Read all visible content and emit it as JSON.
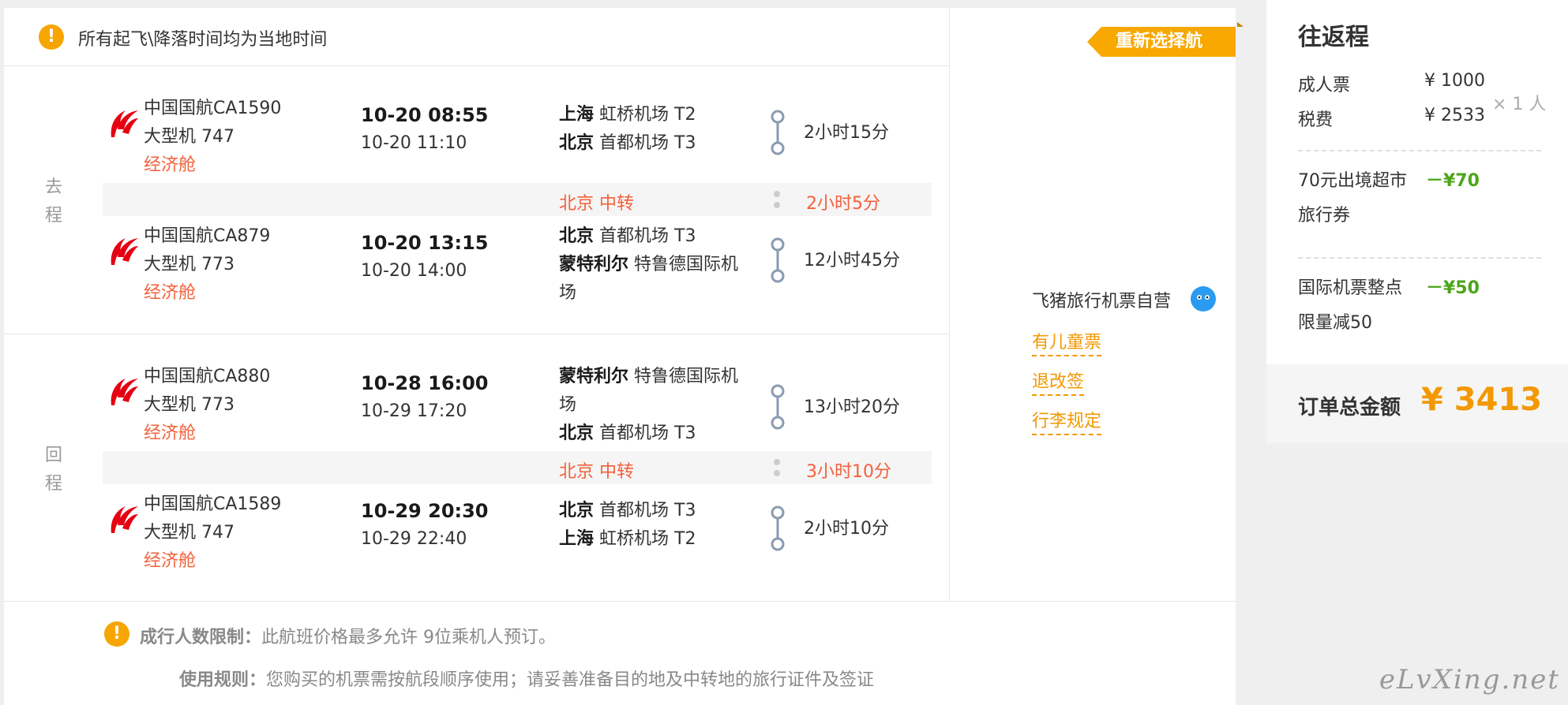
{
  "notice": "所有起飞\\降落时间均为当地时间",
  "reselect_label": "重新选择航班",
  "outbound": {
    "label_1": "去",
    "label_2": "程",
    "seg1": {
      "flight": "中国国航CA1590",
      "aircraft": "大型机 747",
      "cabin": "经济舱",
      "dep": "10-20 08:55",
      "arr": "10-20 11:10",
      "from_city": "上海",
      "from_airport": "虹桥机场 T2",
      "to_city": "北京",
      "to_airport": "首都机场 T3",
      "duration": "2小时15分"
    },
    "transfer": {
      "city": "北京 中转",
      "time": "2小时5分"
    },
    "seg2": {
      "flight": "中国国航CA879",
      "aircraft": "大型机 773",
      "cabin": "经济舱",
      "dep": "10-20 13:15",
      "arr": "10-20 14:00",
      "from_city": "北京",
      "from_airport": "首都机场 T3",
      "to_city": "蒙特利尔",
      "to_airport": "特鲁德国际机",
      "to_airport_2": "场",
      "duration": "12小时45分"
    }
  },
  "return": {
    "label_1": "回",
    "label_2": "程",
    "seg1": {
      "flight": "中国国航CA880",
      "aircraft": "大型机 773",
      "cabin": "经济舱",
      "dep": "10-28 16:00",
      "arr": "10-29 17:20",
      "from_city": "蒙特利尔",
      "from_airport": "特鲁德国际机",
      "from_airport_2": "场",
      "to_city": "北京",
      "to_airport": "首都机场 T3",
      "duration": "13小时20分"
    },
    "transfer": {
      "city": "北京 中转",
      "time": "3小时10分"
    },
    "seg2": {
      "flight": "中国国航CA1589",
      "aircraft": "大型机 747",
      "cabin": "经济舱",
      "dep": "10-29 20:30",
      "arr": "10-29 22:40",
      "from_city": "北京",
      "from_airport": "首都机场 T3",
      "to_city": "上海",
      "to_airport": "虹桥机场 T2",
      "duration": "2小时10分"
    }
  },
  "self_operated": "飞猪旅行机票自营",
  "links": {
    "child": "有儿童票",
    "refund": "退改签",
    "baggage": "行李规定"
  },
  "rules": {
    "limit_label": "成行人数限制：",
    "limit_text": "此航班价格最多允许 9位乘机人预订。",
    "usage_label": "使用规则：",
    "usage_text": "您购买的机票需按航段顺序使用；请妥善准备目的地及中转地的旅行证件及签证"
  },
  "watermark": "eLvXing.net",
  "sidebar": {
    "title": "往返程",
    "adult_label": "成人票",
    "adult_price": "¥ 1000",
    "tax_label": "税费",
    "tax_price": "¥ 2533",
    "multiplier": "× 1 人",
    "promo1_line1": "70元出境超市",
    "promo1_line2": "旅行券",
    "promo1_discount": "－¥70",
    "promo2_line1": "国际机票整点",
    "promo2_line2": "限量减50",
    "promo2_discount": "－¥50",
    "total_label": "订单总金额",
    "total_amount": "¥ 3413"
  },
  "colors": {
    "accent": "#f39800",
    "transfer": "#f4603a",
    "discount": "#4ca51a",
    "airline_red": "#e60012"
  }
}
